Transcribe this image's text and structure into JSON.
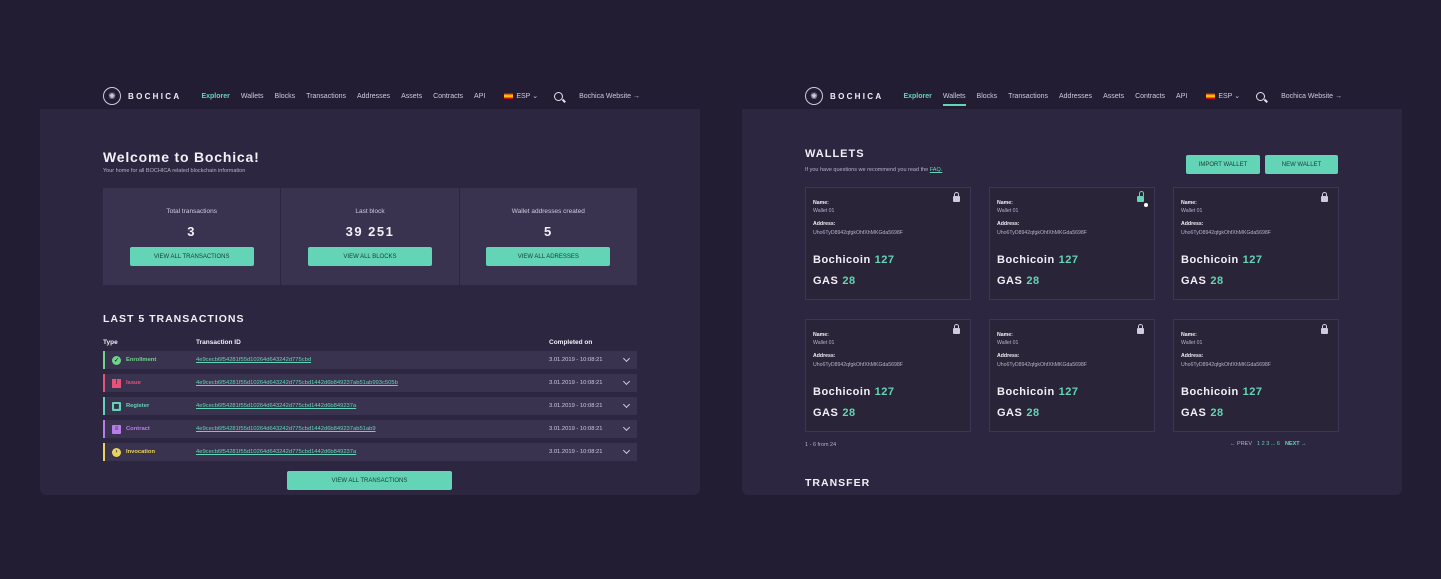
{
  "nav": {
    "logo_text": "BOCHICA",
    "items": [
      "Explorer",
      "Wallets",
      "Blocks",
      "Transactions",
      "Addresses",
      "Assets",
      "Contracts",
      "API"
    ],
    "lang": "ESP",
    "website": "Bochica Website →"
  },
  "explorer": {
    "title": "Welcome to Bochica!",
    "subtitle": "Your home for all BOCHICA related blockchain information",
    "stats": [
      {
        "label": "Total transactions",
        "value": "3",
        "button": "VIEW ALL TRANSACTIONS"
      },
      {
        "label": "Last block",
        "value": "39 251",
        "button": "VIEW ALL BLOCKS"
      },
      {
        "label": "Wallet addresses created",
        "value": "5",
        "button": "VIEW ALL ADRESSES"
      }
    ],
    "last_title": "LAST 5 TRANSACTIONS",
    "headers": {
      "type": "Type",
      "id": "Transaction ID",
      "completed": "Completed on"
    },
    "rows": [
      {
        "type": "Enrollment",
        "id": "4e9cecb6f54281f55d10264d643242d775cbd",
        "date": "3.01.2019 - 10:08:21",
        "color": "#6fd48a",
        "icon": "check-icon",
        "glyph": "✓"
      },
      {
        "type": "Issue",
        "id": "4e9cecb6f54281f55d10264d643242d775cbd1442d6b849237ab51ab993c505b",
        "date": "3.01.2019 - 10:08:21",
        "color": "#e8527a",
        "icon": "warning-icon",
        "glyph": "!"
      },
      {
        "type": "Register",
        "id": "4e9cecb6f54281f55d10264d643242d775cbd1442d6b849237a",
        "date": "3.01.2019 - 10:08:21",
        "color": "#63d4b5",
        "icon": "calendar-icon",
        "glyph": "▦"
      },
      {
        "type": "Contract",
        "id": "4e9cecb6f54281f55d10264d643242d775cbd1442d6b849237ab51ab9",
        "date": "3.01.2019 - 10:08:21",
        "color": "#b87de8",
        "icon": "document-icon",
        "glyph": "≡"
      },
      {
        "type": "Invocation",
        "id": "4e9cecb6f54281f55d10264d643242d775cbd1442d6b849237a",
        "date": "3.01.2019 - 10:08:21",
        "color": "#e8d45a",
        "icon": "arrow-circle-icon",
        "glyph": "›"
      }
    ],
    "view_all": "VIEW ALL TRANSACTIONS"
  },
  "wallets": {
    "title": "WALLETS",
    "subtitle": "If you have questions we recommend you read the",
    "faq": "FAQ.",
    "import": "IMPORT WALLET",
    "new": "NEW WALLET",
    "labels": {
      "name": "Name:",
      "address": "Address:"
    },
    "cards": [
      {
        "name": "Wallet 01",
        "address": "Uho6TyD8942qfgkOhfXhMKGda5698F",
        "coin": "Bochicoin",
        "coin_value": "127",
        "gas": "GAS",
        "gas_value": "28",
        "unlocked": false
      },
      {
        "name": "Wallet 01",
        "address": "Uho6TyD8942qfgkOhfXhMKGda5698F",
        "coin": "Bochicoin",
        "coin_value": "127",
        "gas": "GAS",
        "gas_value": "28",
        "unlocked": true
      },
      {
        "name": "Wallet 01",
        "address": "Uho6TyD8942qfgkOhfXhMKGda5698F",
        "coin": "Bochicoin",
        "coin_value": "127",
        "gas": "GAS",
        "gas_value": "28",
        "unlocked": false
      },
      {
        "name": "Wallet 01",
        "address": "Uho6TyD8942qfgkOhfXhMKGda5698F",
        "coin": "Bochicoin",
        "coin_value": "127",
        "gas": "GAS",
        "gas_value": "28",
        "unlocked": false
      },
      {
        "name": "Wallet 01",
        "address": "Uho6TyD8942qfgkOhfXhMKGda5698F",
        "coin": "Bochicoin",
        "coin_value": "127",
        "gas": "GAS",
        "gas_value": "28",
        "unlocked": false
      },
      {
        "name": "Wallet 01",
        "address": "Uho6TyD8942qfgkOhfXhMKGda5698F",
        "coin": "Bochicoin",
        "coin_value": "127",
        "gas": "GAS",
        "gas_value": "28",
        "unlocked": false
      }
    ],
    "pagination": {
      "range": "1 - 6 from 24",
      "prev": "← PREV",
      "pages": "1 2 3 ... 6",
      "next": "NEXT →"
    },
    "transfer": "TRANSFER"
  }
}
